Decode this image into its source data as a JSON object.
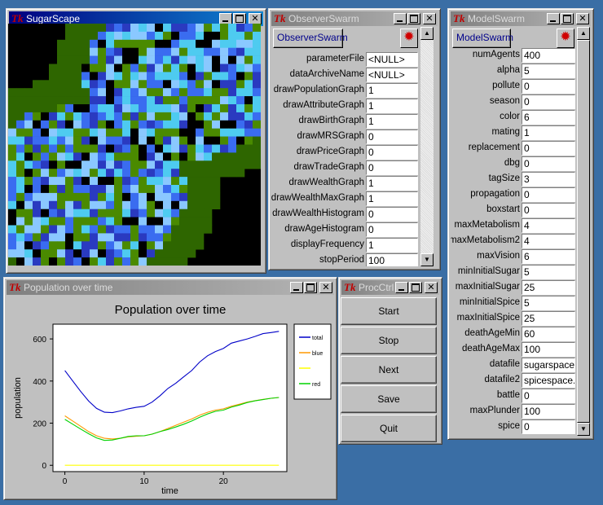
{
  "desktop": {
    "background": "#3a6ea5"
  },
  "sugarscape": {
    "title": "SugarScape",
    "cols": 31,
    "rows": 30,
    "colors": {
      "empty": "#000000",
      "sugar": "#2e6600",
      "sugar_light": "#4a8a00",
      "agent_a": "#3a6cf0",
      "agent_b": "#4ecbf0",
      "agent_c": "#2a3ac0",
      "agent_d": "#8ac8ff"
    }
  },
  "observer": {
    "title": "ObserverSwarm",
    "object_button": "ObserverSwarm",
    "fields": [
      {
        "label": "parameterFile",
        "value": "<NULL>"
      },
      {
        "label": "dataArchiveName",
        "value": "<NULL>"
      },
      {
        "label": "drawPopulationGraph",
        "value": "1"
      },
      {
        "label": "drawAttributeGraph",
        "value": "1"
      },
      {
        "label": "drawBirthGraph",
        "value": "1"
      },
      {
        "label": "drawMRSGraph",
        "value": "0"
      },
      {
        "label": "drawPriceGraph",
        "value": "0"
      },
      {
        "label": "drawTradeGraph",
        "value": "0"
      },
      {
        "label": "drawWealthGraph",
        "value": "1"
      },
      {
        "label": "drawWealthMaxGraph",
        "value": "1"
      },
      {
        "label": "drawWealthHistogram",
        "value": "0"
      },
      {
        "label": "drawAgeHistogram",
        "value": "0"
      },
      {
        "label": "displayFrequency",
        "value": "1"
      },
      {
        "label": "stopPeriod",
        "value": "100"
      }
    ]
  },
  "model": {
    "title": "ModelSwarm",
    "object_button": "ModelSwarm",
    "fields": [
      {
        "label": "numAgents",
        "value": "400"
      },
      {
        "label": "alpha",
        "value": "5"
      },
      {
        "label": "pollute",
        "value": "0"
      },
      {
        "label": "season",
        "value": "0"
      },
      {
        "label": "color",
        "value": "6"
      },
      {
        "label": "mating",
        "value": "1"
      },
      {
        "label": "replacement",
        "value": "0"
      },
      {
        "label": "dbg",
        "value": "0"
      },
      {
        "label": "tagSize",
        "value": "3"
      },
      {
        "label": "propagation",
        "value": "0"
      },
      {
        "label": "boxstart",
        "value": "0"
      },
      {
        "label": "maxMetabolism",
        "value": "4"
      },
      {
        "label": "maxMetabolism2",
        "value": "4"
      },
      {
        "label": "maxVision",
        "value": "6"
      },
      {
        "label": "minInitialSugar",
        "value": "5"
      },
      {
        "label": "maxInitialSugar",
        "value": "25"
      },
      {
        "label": "minInitialSpice",
        "value": "5"
      },
      {
        "label": "maxInitialSpice",
        "value": "25"
      },
      {
        "label": "deathAgeMin",
        "value": "60"
      },
      {
        "label": "deathAgeMax",
        "value": "100"
      },
      {
        "label": "datafile",
        "value": "sugarspace.p"
      },
      {
        "label": "datafile2",
        "value": "spicespace.p"
      },
      {
        "label": "battle",
        "value": "0"
      },
      {
        "label": "maxPlunder",
        "value": "100"
      },
      {
        "label": "spice",
        "value": "0"
      }
    ]
  },
  "population_window": {
    "title": "Population over time"
  },
  "procctrl": {
    "title": "ProcCtrl",
    "buttons": [
      "Start",
      "Stop",
      "Next",
      "Save",
      "Quit"
    ]
  },
  "chart_data": {
    "type": "line",
    "title": "Population over time",
    "xlabel": "time",
    "ylabel": "population",
    "xlim": [
      -1.5,
      28
    ],
    "ylim": [
      -30,
      670
    ],
    "xticks": [
      "0",
      "10",
      "20"
    ],
    "yticks": [
      "0",
      "200",
      "400",
      "600"
    ],
    "legend_position": "right",
    "series": [
      {
        "name": "total",
        "color": "#0000c8",
        "x": [
          0,
          1,
          2,
          3,
          4,
          5,
          6,
          7,
          8,
          9,
          10,
          11,
          12,
          13,
          14,
          15,
          16,
          17,
          18,
          19,
          20,
          21,
          22,
          23,
          24,
          25,
          26,
          27
        ],
        "values": [
          450,
          400,
          350,
          305,
          270,
          252,
          250,
          258,
          268,
          275,
          280,
          300,
          330,
          365,
          390,
          420,
          450,
          490,
          520,
          540,
          555,
          580,
          590,
          600,
          612,
          625,
          630,
          636
        ]
      },
      {
        "name": "blue",
        "color": "#ff9900",
        "x": [
          0,
          1,
          2,
          3,
          4,
          5,
          6,
          7,
          8,
          9,
          10,
          11,
          12,
          13,
          14,
          15,
          16,
          17,
          18,
          19,
          20,
          21,
          22,
          23,
          24,
          25,
          26,
          27
        ],
        "values": [
          235,
          210,
          185,
          160,
          140,
          128,
          125,
          128,
          135,
          138,
          140,
          148,
          160,
          175,
          190,
          205,
          220,
          238,
          252,
          262,
          268,
          280,
          290,
          300,
          307,
          313,
          318,
          322
        ]
      },
      {
        "name": "",
        "color": "#ffff00",
        "x": [
          0,
          27
        ],
        "values": [
          0,
          0
        ]
      },
      {
        "name": "red",
        "color": "#00d200",
        "x": [
          0,
          1,
          2,
          3,
          4,
          5,
          6,
          7,
          8,
          9,
          10,
          11,
          12,
          13,
          14,
          15,
          16,
          17,
          18,
          19,
          20,
          21,
          22,
          23,
          24,
          25,
          26,
          27
        ],
        "values": [
          218,
          195,
          172,
          150,
          130,
          118,
          120,
          128,
          137,
          140,
          140,
          148,
          160,
          170,
          182,
          195,
          210,
          228,
          244,
          256,
          262,
          276,
          286,
          298,
          306,
          312,
          318,
          322
        ]
      }
    ]
  }
}
